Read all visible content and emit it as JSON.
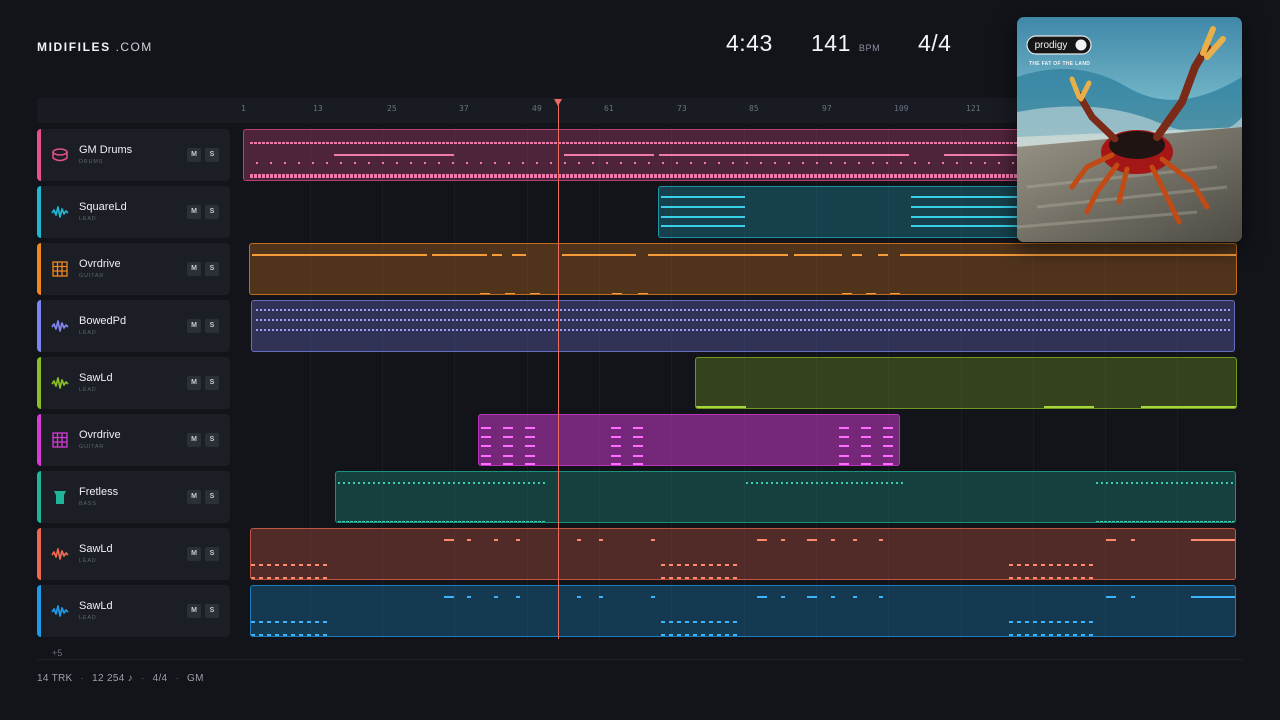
{
  "brand": {
    "name": "MIDIFILES",
    "domain": ".COM"
  },
  "stats": {
    "time": "4:43",
    "bpm": "141",
    "bpm_unit": "BPM",
    "signature": "4/4"
  },
  "cover": {
    "band": "prodigy",
    "album": "THE FAT OF THE LAND"
  },
  "ruler": {
    "ticks": [
      "1",
      "13",
      "25",
      "37",
      "49",
      "61",
      "73",
      "85",
      "97",
      "109",
      "121"
    ]
  },
  "tracks": [
    {
      "name": "GM Drums",
      "type": "DRUMS",
      "color": "#e8508e",
      "icon": "drum-icon"
    },
    {
      "name": "SquareLd",
      "type": "LEAD",
      "color": "#1fb8d0",
      "icon": "wave-icon"
    },
    {
      "name": "Ovrdrive",
      "type": "GUITAR",
      "color": "#f0861f",
      "icon": "grid-icon"
    },
    {
      "name": "BowedPd",
      "type": "LEAD",
      "color": "#7f84f0",
      "icon": "wave-icon"
    },
    {
      "name": "SawLd",
      "type": "LEAD",
      "color": "#8bbd24",
      "icon": "wave-icon"
    },
    {
      "name": "Ovrdrive",
      "type": "GUITAR",
      "color": "#d83ad8",
      "icon": "grid-icon"
    },
    {
      "name": "Fretless",
      "type": "BASS",
      "color": "#1fb59a",
      "icon": "bass-icon"
    },
    {
      "name": "SawLd",
      "type": "LEAD",
      "color": "#f0684f",
      "icon": "wave-icon"
    },
    {
      "name": "SawLd",
      "type": "LEAD",
      "color": "#1f9ae6",
      "icon": "wave-icon"
    }
  ],
  "mute_label": "M",
  "solo_label": "S",
  "more_tracks": "+5",
  "footer": {
    "tracks": "14 TRK",
    "notes": "12 254 ♪",
    "signature": "4/4",
    "standard": "GM"
  }
}
